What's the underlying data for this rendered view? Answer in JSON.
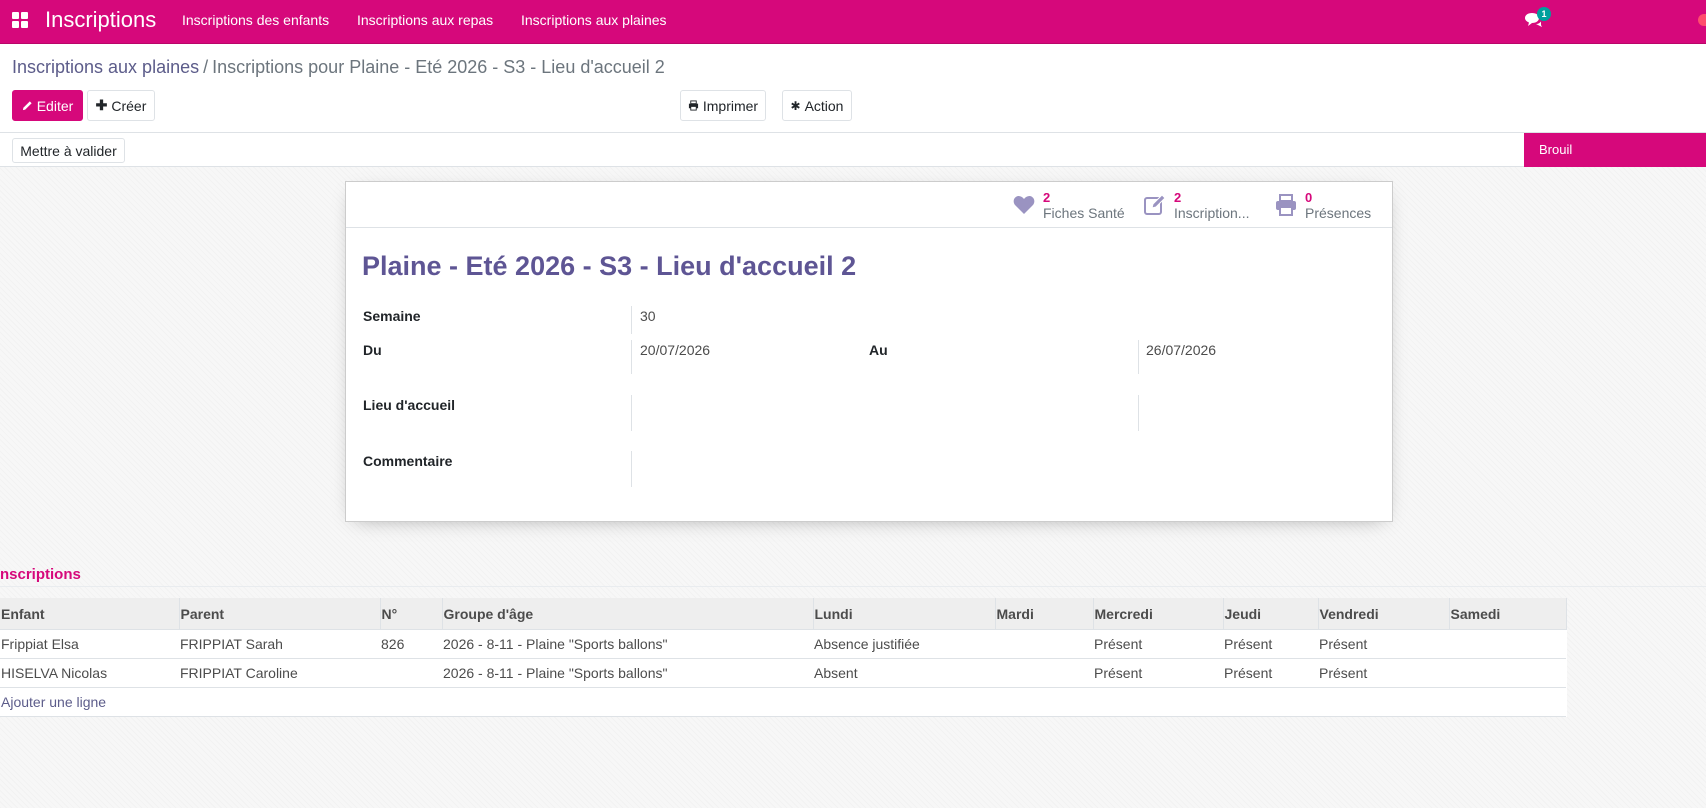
{
  "navbar": {
    "brand": "Inscriptions",
    "menu": [
      "Inscriptions des enfants",
      "Inscriptions aux repas",
      "Inscriptions aux plaines"
    ],
    "chat_badge": "1",
    "accent": "#d6087b",
    "icons": [
      "apps-grid-icon",
      "chat-icon"
    ]
  },
  "breadcrumb": {
    "parent": "Inscriptions aux plaines",
    "separator": "/",
    "current": "Inscriptions pour Plaine - Eté 2026 - S3 - Lieu d'accueil 2"
  },
  "buttons": {
    "edit": "Editer",
    "create": "Créer",
    "print": "Imprimer",
    "action": "Action",
    "to_validate": "Mettre à valider"
  },
  "status": {
    "current": "Brouil"
  },
  "smart_buttons": [
    {
      "value": "2",
      "label": "Fiches Santé",
      "icon": "heart-icon"
    },
    {
      "value": "2",
      "label": "Inscription...",
      "icon": "edit-icon"
    },
    {
      "value": "0",
      "label": "Présences",
      "icon": "print-icon"
    }
  ],
  "form": {
    "title": "Plaine - Eté 2026 - S3 - Lieu d'accueil 2",
    "labels": {
      "week": "Semaine",
      "from": "Du",
      "to": "Au",
      "location": "Lieu d'accueil",
      "comment": "Commentaire"
    },
    "values": {
      "week": "30",
      "from": "20/07/2026",
      "to": "26/07/2026",
      "location": "",
      "comment": ""
    }
  },
  "inscriptions": {
    "title": "nscriptions",
    "columns": [
      "Enfant",
      "Parent",
      "N°",
      "Groupe d'âge",
      "Lundi",
      "Mardi",
      "Mercredi",
      "Jeudi",
      "Vendredi",
      "Samedi"
    ],
    "rows": [
      [
        "Frippiat Elsa",
        "FRIPPIAT Sarah",
        "826",
        "2026 - 8-11 - Plaine \"Sports ballons\"",
        "Absence justifiée",
        "",
        "Présent",
        "Présent",
        "Présent",
        ""
      ],
      [
        "HISELVA Nicolas",
        "FRIPPIAT Caroline",
        "",
        "2026 - 8-11 - Plaine \"Sports ballons\"",
        "Absent",
        "",
        "Présent",
        "Présent",
        "Présent",
        ""
      ]
    ],
    "add_line": "Ajouter une ligne"
  }
}
